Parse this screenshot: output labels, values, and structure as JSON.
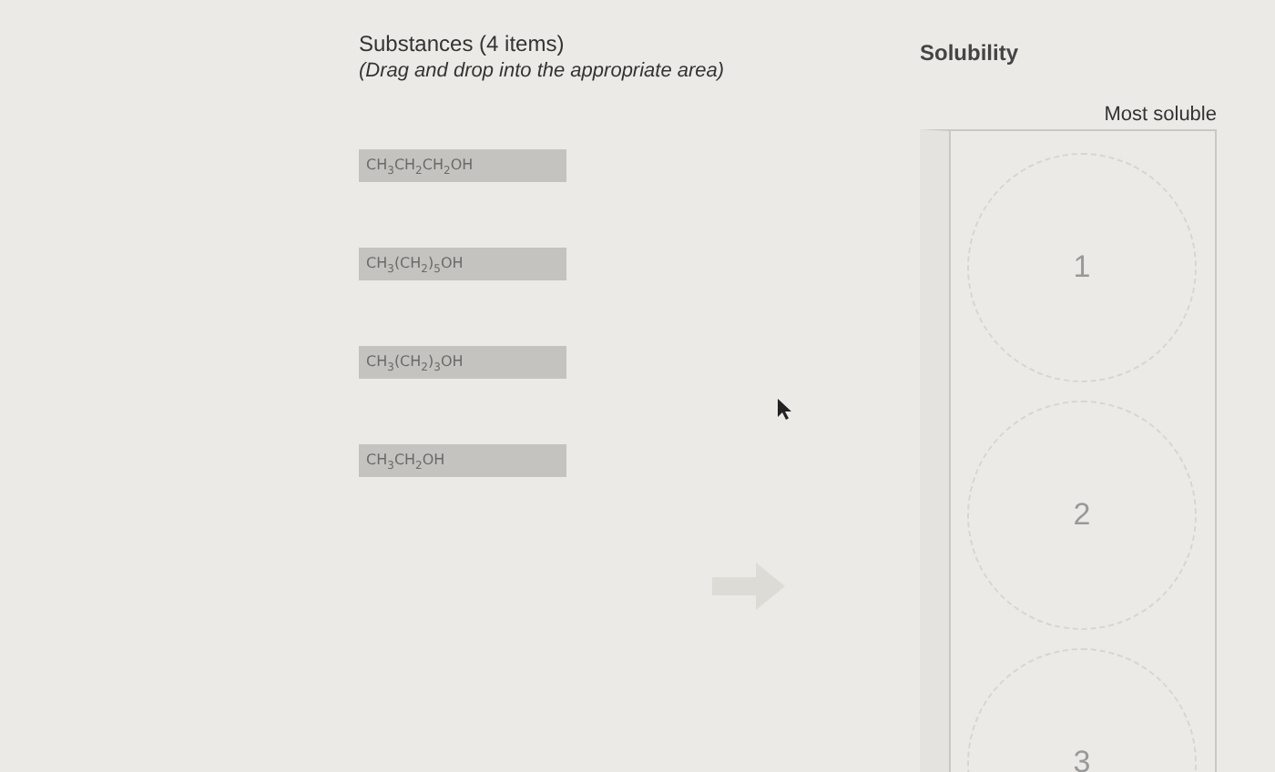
{
  "substances": {
    "title": "Substances (4 items)",
    "instruction": "(Drag and drop into the appropriate area)",
    "items": [
      {
        "formula": "CH$_{3}$CH$_{2}$CH$_{2}$OH"
      },
      {
        "formula": "CH$_{3}$(CH$_{2}$)$_{5}$OH"
      },
      {
        "formula": "CH$_{3}$(CH$_{2}$)$_{3}$OH"
      },
      {
        "formula": "CH$_{3}$CH$_{2}$OH"
      }
    ]
  },
  "solubility": {
    "title": "Solubility",
    "top_label": "Most soluble",
    "slots": [
      {
        "number": "1"
      },
      {
        "number": "2"
      },
      {
        "number": "3"
      }
    ]
  }
}
